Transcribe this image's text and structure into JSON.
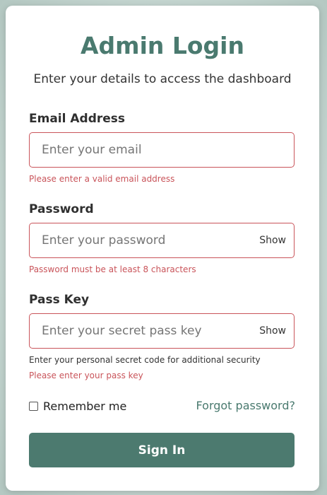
{
  "header": {
    "title": "Admin Login",
    "subtitle": "Enter your details to access the dashboard"
  },
  "email": {
    "label": "Email Address",
    "placeholder": "Enter your email",
    "value": "",
    "error": "Please enter a valid email address"
  },
  "password": {
    "label": "Password",
    "placeholder": "Enter your password",
    "value": "",
    "toggle_label": "Show",
    "error": "Password must be at least 8 characters"
  },
  "passkey": {
    "label": "Pass Key",
    "placeholder": "Enter your secret pass key",
    "value": "",
    "toggle_label": "Show",
    "hint": "Enter your personal secret code for additional security",
    "error": "Please enter your pass key"
  },
  "options": {
    "remember_label": "Remember me",
    "remember_checked": false,
    "forgot_label": "Forgot password?"
  },
  "actions": {
    "signin_label": "Sign In"
  },
  "colors": {
    "accent": "#4c7a6f",
    "error": "#c9545a"
  }
}
